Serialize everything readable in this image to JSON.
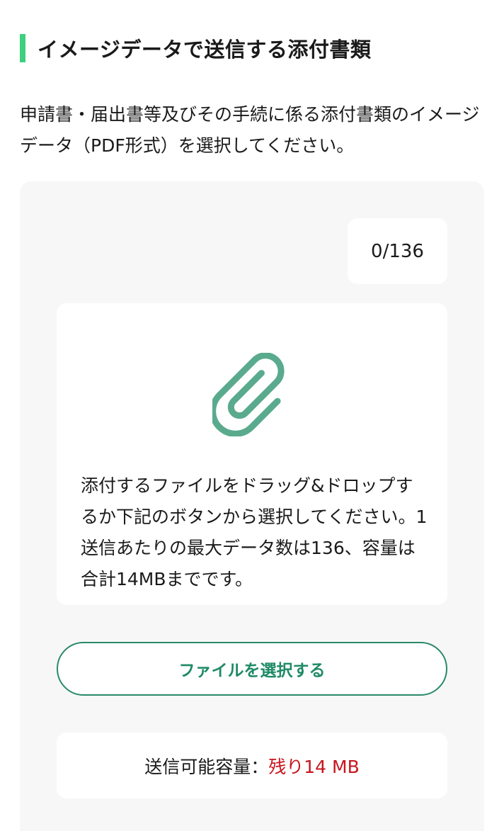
{
  "section": {
    "title": "イメージデータで送信する添付書類",
    "description": "申請書・届出書等及びその手続に係る添付書類のイメージデータ（PDF形式）を選択してください。"
  },
  "upload": {
    "counter": "0/136",
    "drop_instructions": "添付するファイルをドラッグ&ドロップするか下記のボタンから選択してください。1送信あたりの最大データ数は136、容量は合計14MBまでです。",
    "select_button_label": "ファイルを選択する",
    "capacity_label": "送信可能容量：",
    "capacity_remaining": "残り14 MB"
  },
  "colors": {
    "accent_bar": "#3ecf7f",
    "button_text": "#1e8a66",
    "clip_icon": "#5aaa8e",
    "remaining_text": "#c8141e"
  },
  "icons": {
    "attachment": "paperclip-icon"
  }
}
